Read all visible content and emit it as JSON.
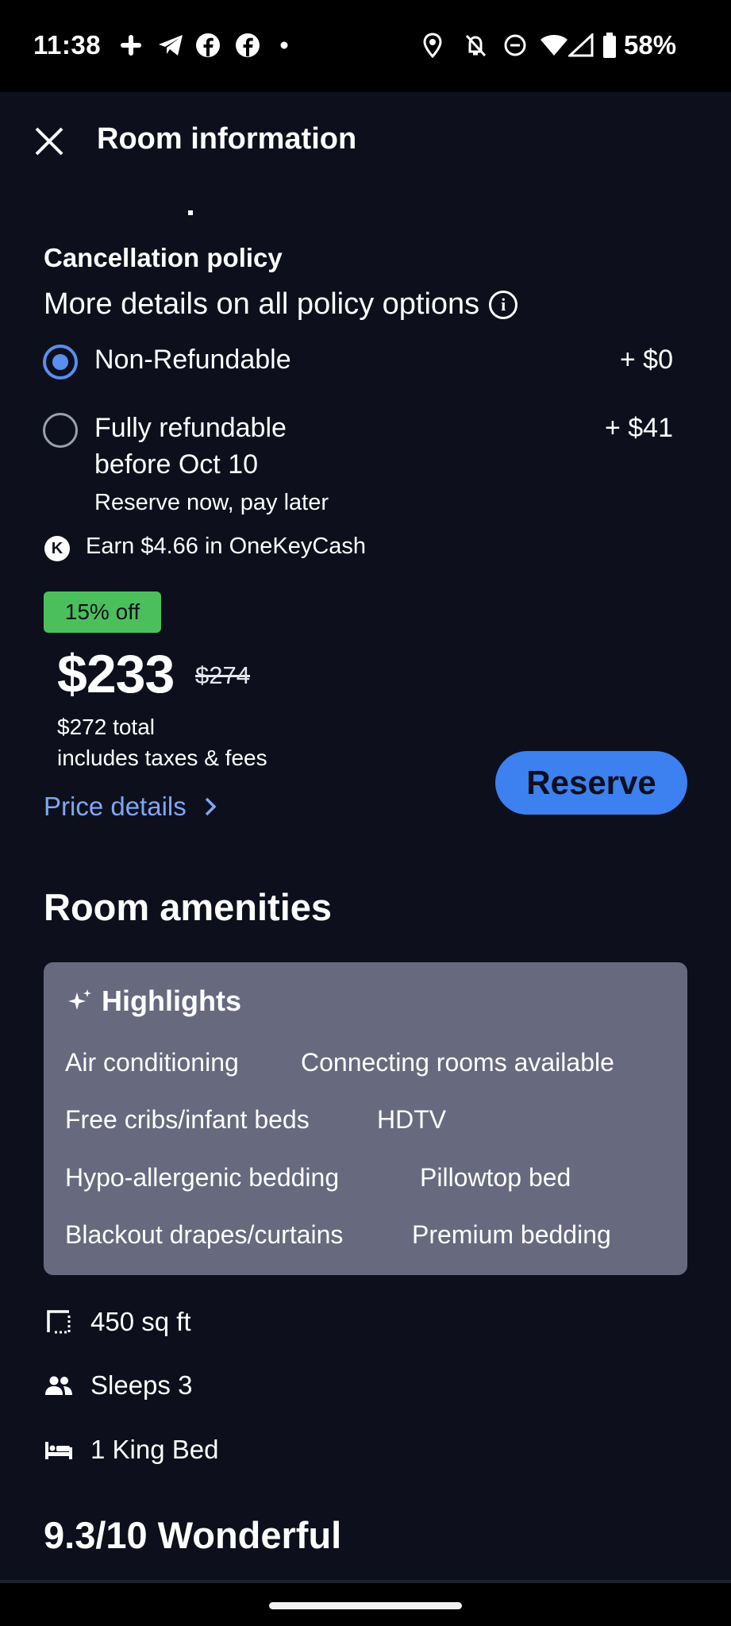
{
  "status_bar": {
    "time": "11:38",
    "battery": "58%",
    "left_icons": [
      "slack-icon",
      "telegram-icon",
      "facebook-icon",
      "facebook-icon",
      "dot-icon"
    ],
    "right_icons": [
      "location-icon",
      "bell-off-icon",
      "do-not-disturb-icon",
      "wifi-icon",
      "signal-icon",
      "battery-icon"
    ]
  },
  "header": {
    "title": "Room information",
    "close_icon": "close-icon"
  },
  "cancellation": {
    "title": "Cancellation policy",
    "details_link": "More details on all policy options",
    "options": [
      {
        "label": "Non-Refundable",
        "label_line2": "",
        "sub": "",
        "price": "+ $0",
        "selected": true
      },
      {
        "label": "Fully refundable",
        "label_line2": "before Oct 10",
        "sub": "Reserve now, pay later",
        "price": "+ $41",
        "selected": false
      }
    ],
    "onekeycash": "Earn $4.66 in OneKeyCash"
  },
  "pricing": {
    "discount_badge": "15% off",
    "current_price": "$233",
    "original_price": "$274",
    "total": "$272 total",
    "note": "includes taxes & fees",
    "details_link": "Price details",
    "reserve_label": "Reserve"
  },
  "amenities": {
    "title": "Room amenities",
    "highlights_title": "Highlights",
    "highlights": [
      [
        "Air conditioning",
        "Connecting rooms available"
      ],
      [
        "Free cribs/infant beds",
        "HDTV"
      ],
      [
        "Hypo-allergenic bedding",
        "Pillowtop bed"
      ],
      [
        "Blackout drapes/curtains",
        "Premium bedding"
      ]
    ],
    "details": [
      {
        "icon": "area-icon",
        "text": "450 sq ft"
      },
      {
        "icon": "people-icon",
        "text": "Sleeps 3"
      },
      {
        "icon": "bed-icon",
        "text": "1 King Bed"
      }
    ]
  },
  "rating": {
    "title": "9.3/10 Wonderful"
  },
  "colors": {
    "background": "#0d101c",
    "accent": "#3d80f0",
    "link": "#7fa6f5",
    "badge": "#4bbf5c",
    "card": "#676a7e"
  }
}
